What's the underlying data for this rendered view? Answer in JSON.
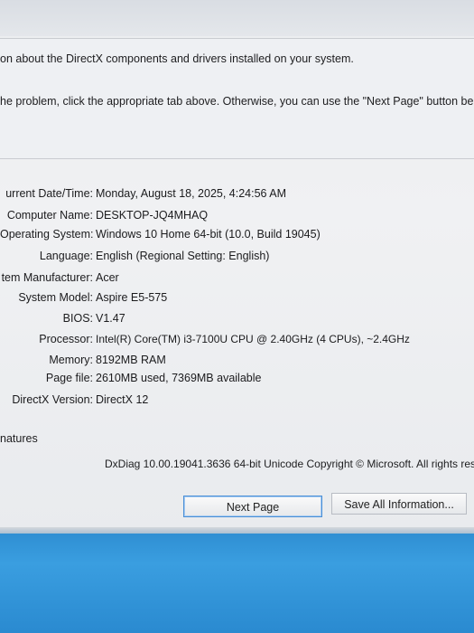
{
  "intro": {
    "line1": "on about the DirectX components and drivers installed on your system.",
    "line2": "he problem, click the appropriate tab above.  Otherwise, you can use the \"Next Page\" button belo"
  },
  "system_information": [
    {
      "label": "urrent Date/Time:",
      "value": "Monday, August 18, 2025, 4:24:56 AM"
    },
    {
      "label": "Computer Name:",
      "value": "DESKTOP-JQ4MHAQ"
    },
    {
      "label": "Operating System:",
      "value": "Windows 10 Home 64-bit (10.0, Build 19045)"
    },
    {
      "label": "Language:",
      "value": "English (Regional Setting: English)"
    },
    {
      "label": "tem Manufacturer:",
      "value": "Acer"
    },
    {
      "label": "System Model:",
      "value": "Aspire E5-575"
    },
    {
      "label": "BIOS:",
      "value": "V1.47"
    },
    {
      "label": "Processor:",
      "value": "Intel(R) Core(TM) i3-7100U CPU @ 2.40GHz (4 CPUs), ~2.4GHz"
    },
    {
      "label": "Memory:",
      "value": "8192MB RAM"
    },
    {
      "label": "Page file:",
      "value": "2610MB used, 7369MB available"
    },
    {
      "label": "DirectX Version:",
      "value": "DirectX 12"
    }
  ],
  "signatures_label": "natures",
  "footer": {
    "copyright": "DxDiag 10.00.19041.3636 64-bit Unicode  Copyright © Microsoft. All rights res"
  },
  "buttons": {
    "next_page": "Next Page",
    "save_all": "Save All Information..."
  }
}
